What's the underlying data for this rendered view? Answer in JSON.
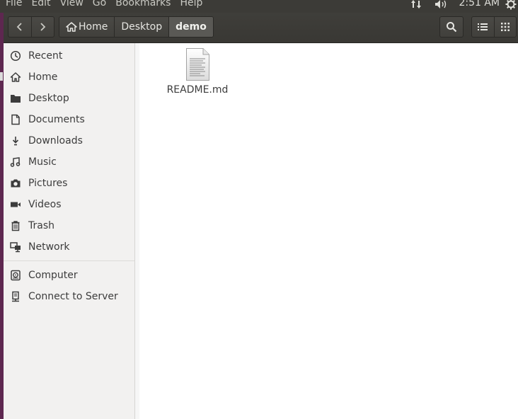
{
  "menubar": {
    "menus": [
      "File",
      "Edit",
      "View",
      "Go",
      "Bookmarks",
      "Help"
    ],
    "time": "2:51 AM"
  },
  "breadcrumb": [
    "Home",
    "Desktop",
    "demo"
  ],
  "sidebar": {
    "places": [
      {
        "label": "Recent",
        "icon": "clock-icon"
      },
      {
        "label": "Home",
        "icon": "home-icon"
      },
      {
        "label": "Desktop",
        "icon": "folder-icon"
      },
      {
        "label": "Documents",
        "icon": "document-icon"
      },
      {
        "label": "Downloads",
        "icon": "download-icon"
      },
      {
        "label": "Music",
        "icon": "music-icon"
      },
      {
        "label": "Pictures",
        "icon": "camera-icon"
      },
      {
        "label": "Videos",
        "icon": "video-icon"
      },
      {
        "label": "Trash",
        "icon": "trash-icon"
      },
      {
        "label": "Network",
        "icon": "network-icon"
      }
    ],
    "devices": [
      {
        "label": "Computer",
        "icon": "computer-icon"
      },
      {
        "label": "Connect to Server",
        "icon": "server-icon"
      }
    ]
  },
  "files": [
    {
      "name": "README.md",
      "icon": "text-file-icon"
    }
  ],
  "colors": {
    "menubar_bg": "#3c3b37",
    "headerbar_bg": "#3f3e3a",
    "sidebar_bg": "#f2f1f0",
    "launcher_edge": "#5e2750"
  }
}
